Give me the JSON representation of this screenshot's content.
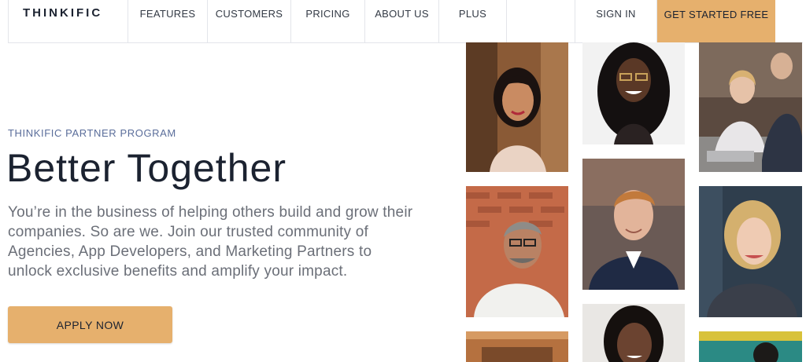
{
  "nav": {
    "logo": "THINKIFIC",
    "items": [
      {
        "label": "FEATURES"
      },
      {
        "label": "CUSTOMERS"
      },
      {
        "label": "PRICING"
      },
      {
        "label": "ABOUT US"
      },
      {
        "label": "PLUS"
      }
    ],
    "sign_in": "SIGN IN",
    "cta": "GET STARTED FREE"
  },
  "hero": {
    "eyebrow": "THINKIFIC PARTNER PROGRAM",
    "title": "Better Together",
    "body": "You’re in the business of helping others build and grow their companies. So are we. Join our trusted community of Agencies, App Developers, and Marketing Partners to unlock exclusive benefits and amplify your impact.",
    "button": "APPLY NOW"
  },
  "colors": {
    "accent": "#e6b06d",
    "eyebrow": "#5a6d9a",
    "body_text": "#6b6f78",
    "heading": "#1b2230"
  }
}
